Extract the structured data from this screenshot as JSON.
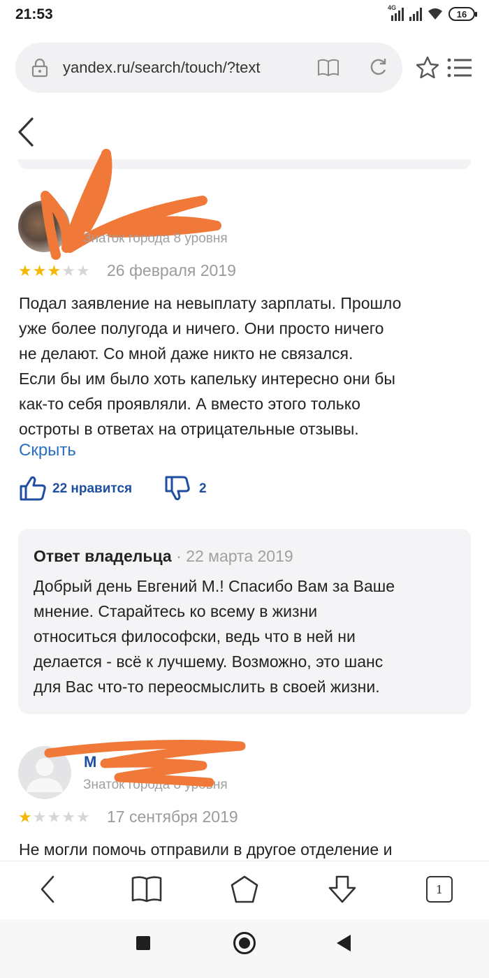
{
  "status_bar": {
    "time": "21:53",
    "network": "4G",
    "battery": "16"
  },
  "browser": {
    "url": "yandex.ru/search/touch/?text",
    "tab_count": "1"
  },
  "reviews": [
    {
      "author_level": "Знаток города 8 уровня",
      "rating": 3,
      "rating_max": 5,
      "date": "26 февраля 2019",
      "text_lines": [
        "Подал заявление на невыплату зарплаты. Прошло",
        "уже более полугода и ничего. Они просто ничего",
        "не делают. Со мной даже никто не связался.",
        "Если бы им было хоть капельку интересно они бы",
        "как-то себя проявляли. А вместо этого только",
        "остроты в ответах на отрицательные отзывы."
      ],
      "hide_label": "Скрыть",
      "likes_label": "22 нравится",
      "dislikes_label": "2",
      "owner_reply": {
        "author": "Ответ владельца",
        "separator": "·",
        "date": "22 марта 2019",
        "text_lines": [
          "Добрый день Евгений М.! Спасибо Вам за Ваше",
          "мнение. Старайтесь ко всему в жизни",
          "относиться философски, ведь что в ней ни",
          "делается - всё к лучшему. Возможно, это шанс",
          "для Вас что-то переосмыслить в своей жизни."
        ]
      }
    },
    {
      "author_name": "М    с",
      "author_level": "Знаток города 8 уровня",
      "rating": 1,
      "rating_max": 5,
      "date": "17 сентября 2019",
      "text_lines": [
        "Не могли помочь отправили в другое отделение и"
      ]
    }
  ],
  "colors": {
    "link": "#2a6fc0",
    "action": "#1e4ea0",
    "star_on": "#f5b700",
    "star_off": "#d6d6d6",
    "redaction": "#f07838"
  }
}
